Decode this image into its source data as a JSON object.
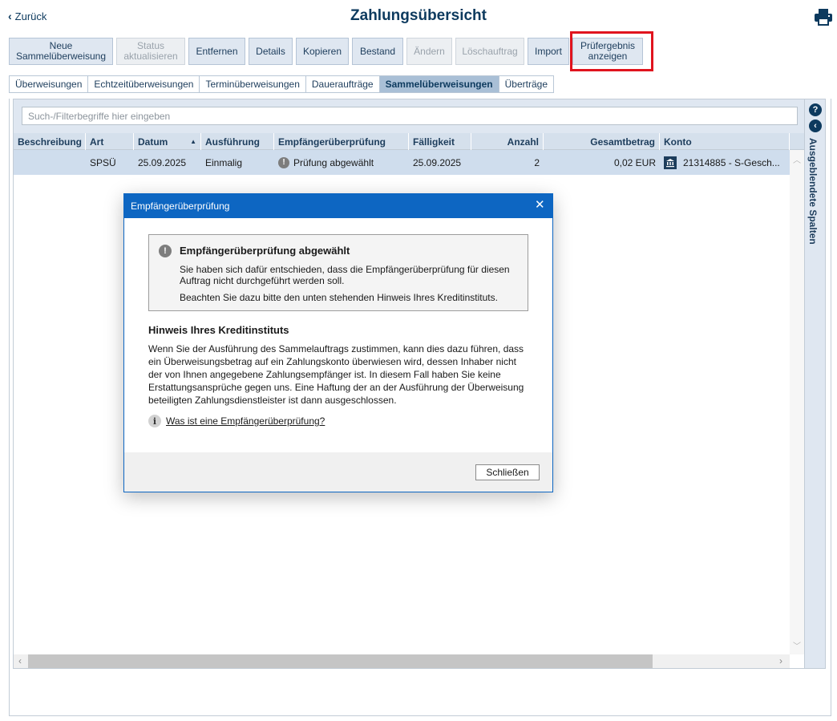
{
  "header": {
    "back_label": "Zurück",
    "title": "Zahlungsübersicht",
    "print_icon": "printer-icon"
  },
  "toolbar": [
    {
      "label": "Neue\nSammelüberweisung",
      "width": 130,
      "disabled": false
    },
    {
      "label": "Status\naktualisieren",
      "width": 86,
      "disabled": true
    },
    {
      "label": "Entfernen",
      "width": 71,
      "disabled": false
    },
    {
      "label": "Details",
      "width": 55,
      "disabled": false
    },
    {
      "label": "Kopieren",
      "width": 66,
      "disabled": false
    },
    {
      "label": "Bestand",
      "width": 64,
      "disabled": false
    },
    {
      "label": "Ändern",
      "width": 57,
      "disabled": true
    },
    {
      "label": "Löschauftrag",
      "width": 86,
      "disabled": true
    },
    {
      "label": "Import",
      "width": 52,
      "disabled": false
    },
    {
      "label": "Prüfergebnis\nanzeigen",
      "width": 88,
      "disabled": false
    }
  ],
  "tabs": [
    {
      "label": "Überweisungen",
      "active": false
    },
    {
      "label": "Echtzeitüberweisungen",
      "active": false
    },
    {
      "label": "Terminüberweisungen",
      "active": false
    },
    {
      "label": "Daueraufträge",
      "active": false
    },
    {
      "label": "Sammelüberweisungen",
      "active": true
    },
    {
      "label": "Überträge",
      "active": false
    }
  ],
  "search": {
    "placeholder": "Such-/Filterbegriffe hier eingeben"
  },
  "table": {
    "columns": [
      {
        "label": "Beschreibung",
        "width": 90,
        "align": "left"
      },
      {
        "label": "Art",
        "width": 60,
        "align": "left"
      },
      {
        "label": "Datum",
        "width": 84,
        "align": "left",
        "sorted": "asc"
      },
      {
        "label": "Ausführung",
        "width": 91,
        "align": "left"
      },
      {
        "label": "Empfängerüberprüfung",
        "width": 168,
        "align": "left"
      },
      {
        "label": "Fälligkeit",
        "width": 78,
        "align": "left"
      },
      {
        "label": "Anzahl",
        "width": 90,
        "align": "right"
      },
      {
        "label": "Gesamtbetrag",
        "width": 145,
        "align": "right"
      },
      {
        "label": "Konto",
        "width": 162,
        "align": "left"
      }
    ],
    "rows": [
      {
        "Beschreibung": "",
        "Art": "SPSÜ",
        "Datum": "25.09.2025",
        "Ausführung": "Einmalig",
        "Empfängerüberprüfung": "Prüfung abgewählt",
        "Fälligkeit": "25.09.2025",
        "Anzahl": "2",
        "Gesamtbetrag": "0,02 EUR",
        "Konto": "21314885 - S-Gesch..."
      }
    ]
  },
  "side_panel": {
    "label": "Ausgeblendete Spalten"
  },
  "dialog": {
    "title": "Empfängerüberprüfung",
    "info_title": "Empfängerüberprüfung abgewählt",
    "info_text1": "Sie haben sich dafür entschieden, dass die Empfängerüberprüfung für diesen Auftrag nicht durchgeführt werden soll.",
    "info_text2": "Beachten Sie dazu bitte den unten stehenden Hinweis Ihres Kreditinstituts.",
    "hint_title": "Hinweis Ihres Kreditinstituts",
    "hint_text": "Wenn Sie der Ausführung des Sammelauftrags zustimmen, kann dies dazu führen, dass ein Überweisungsbetrag auf ein Zahlungskonto überwiesen wird, dessen Inhaber nicht der von Ihnen angegebene Zahlungsempfänger ist. In diesem Fall haben Sie keine Erstattungsansprüche gegen uns. Eine Haftung der an der Ausführung der Überweisung beteiligten Zahlungsdienstleister ist dann ausgeschlossen.",
    "link_label": "Was ist eine Empfängerüberprüfung?",
    "close_label": "Schließen"
  }
}
